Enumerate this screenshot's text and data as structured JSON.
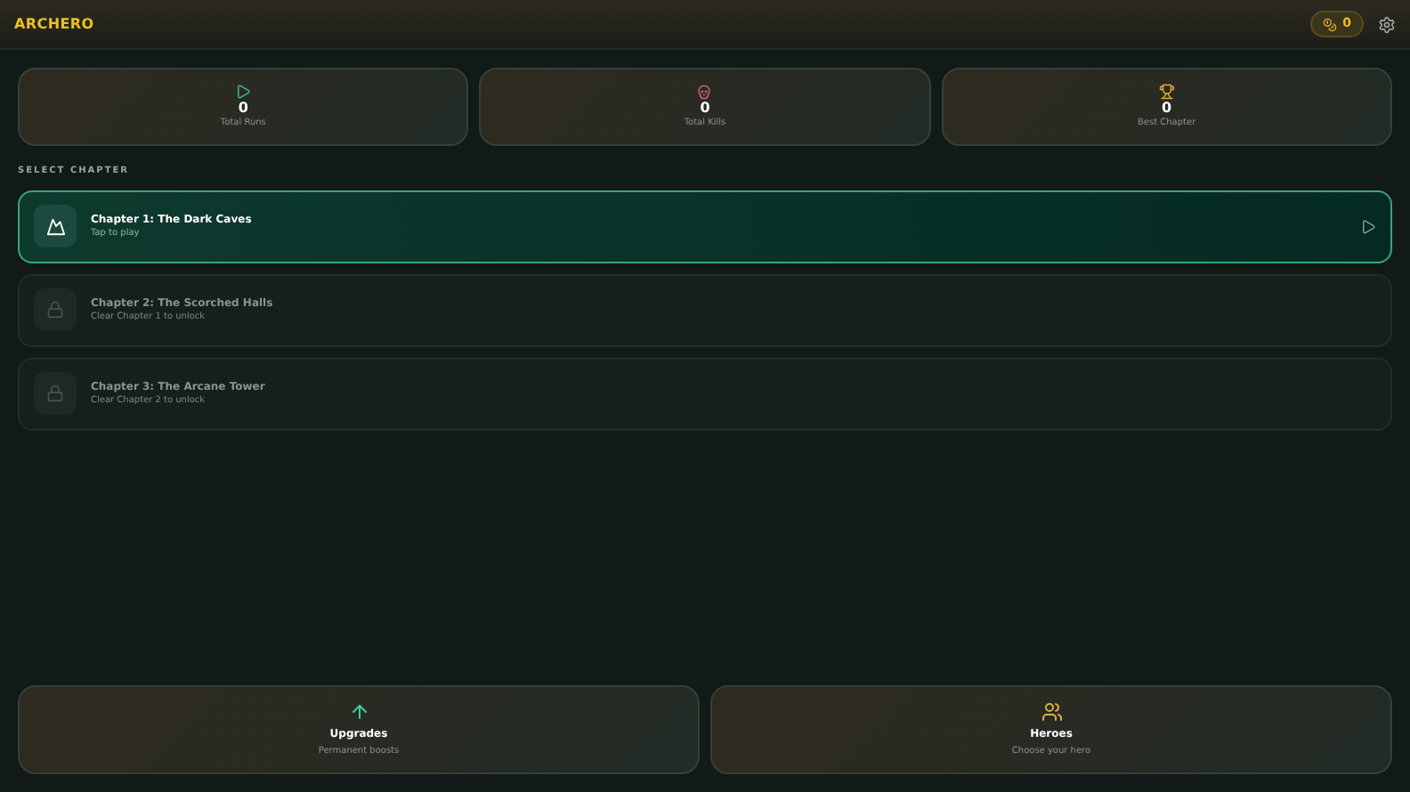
{
  "header": {
    "title": "ARCHERO",
    "coins": "0"
  },
  "stats": [
    {
      "kind": "runs",
      "value": "0",
      "label": "Total Runs"
    },
    {
      "kind": "kills",
      "value": "0",
      "label": "Total Kills"
    },
    {
      "kind": "chapter",
      "value": "0",
      "label": "Best Chapter"
    }
  ],
  "section_label": "SELECT CHAPTER",
  "chapters": [
    {
      "title": "Chapter 1: The Dark Caves",
      "subtitle": "Tap to play",
      "locked": false
    },
    {
      "title": "Chapter 2: The Scorched Halls",
      "subtitle": "Clear Chapter 1 to unlock",
      "locked": true
    },
    {
      "title": "Chapter 3: The Arcane Tower",
      "subtitle": "Clear Chapter 2 to unlock",
      "locked": true
    }
  ],
  "actions": [
    {
      "kind": "upgrades",
      "title": "Upgrades",
      "subtitle": "Permanent boosts"
    },
    {
      "kind": "heroes",
      "title": "Heroes",
      "subtitle": "Choose your hero"
    }
  ]
}
